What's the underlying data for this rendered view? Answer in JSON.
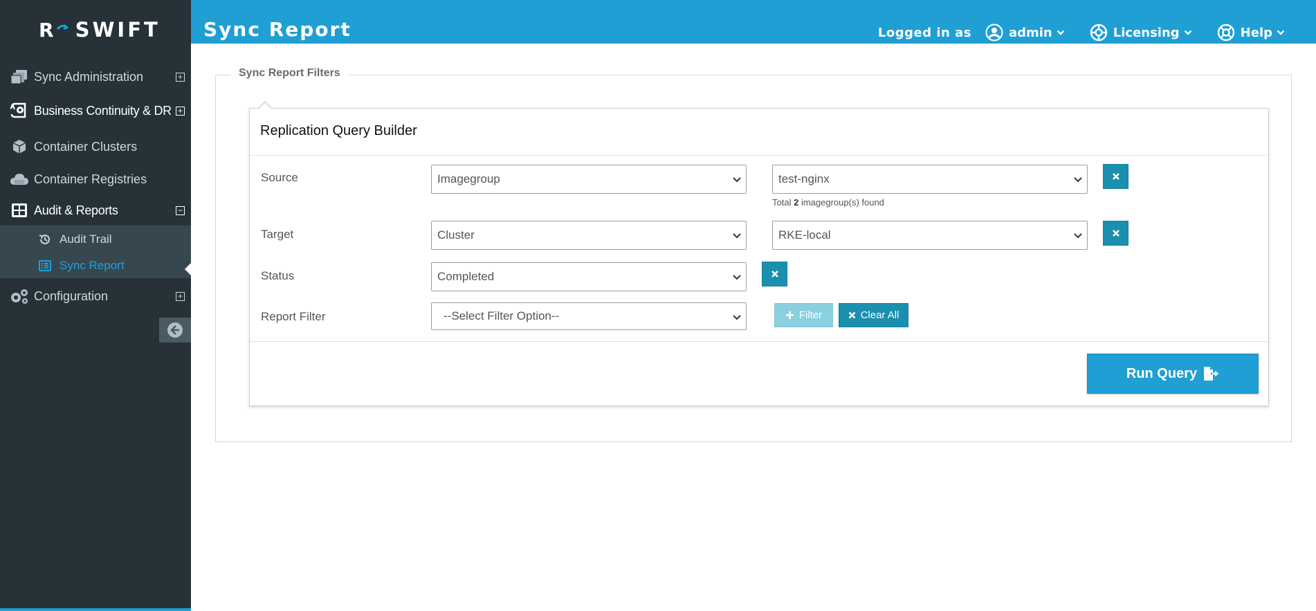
{
  "app": {
    "logo_mark": "R",
    "logo_text": "SWIFT"
  },
  "sidebar": {
    "items": [
      {
        "label": "Sync Administration",
        "icon": "sync-admin-icon",
        "toggle": "+"
      },
      {
        "label": "Business Continuity & DR",
        "icon": "business-continuity-icon",
        "toggle": "+"
      },
      {
        "label": "Container Clusters",
        "icon": "cube-icon"
      },
      {
        "label": "Container Registries",
        "icon": "cloud-icon"
      },
      {
        "label": "Audit & Reports",
        "icon": "table-grid-icon",
        "toggle": "−"
      },
      {
        "label": "Configuration",
        "icon": "gears-icon",
        "toggle": "+"
      }
    ],
    "subitems": [
      {
        "label": "Audit Trail",
        "icon": "history-icon"
      },
      {
        "label": "Sync Report",
        "icon": "list-icon",
        "active": true
      }
    ]
  },
  "header": {
    "title": "Sync Report",
    "logged_in_as": "Logged in as",
    "user": "admin",
    "licensing": "Licensing",
    "help": "Help"
  },
  "filters": {
    "legend": "Sync Report Filters",
    "builder_title": "Replication Query Builder",
    "source": {
      "label": "Source",
      "type_value": "Imagegroup",
      "item_value": "test-nginx",
      "hint_prefix": "Total",
      "hint_count": "2",
      "hint_suffix": "imagegroup(s) found"
    },
    "target": {
      "label": "Target",
      "type_value": "Cluster",
      "item_value": "RKE-local"
    },
    "status": {
      "label": "Status",
      "value": "Completed"
    },
    "report_filter": {
      "label": "Report Filter",
      "placeholder": "--Select Filter Option--"
    },
    "filter_button": "Filter",
    "clear_button": "Clear All",
    "run_button": "Run Query"
  },
  "colors": {
    "accent": "#1f9fd3",
    "sidebar_bg": "#263238",
    "button_teal": "#1a8fae",
    "active_link": "#1ea1dc"
  }
}
